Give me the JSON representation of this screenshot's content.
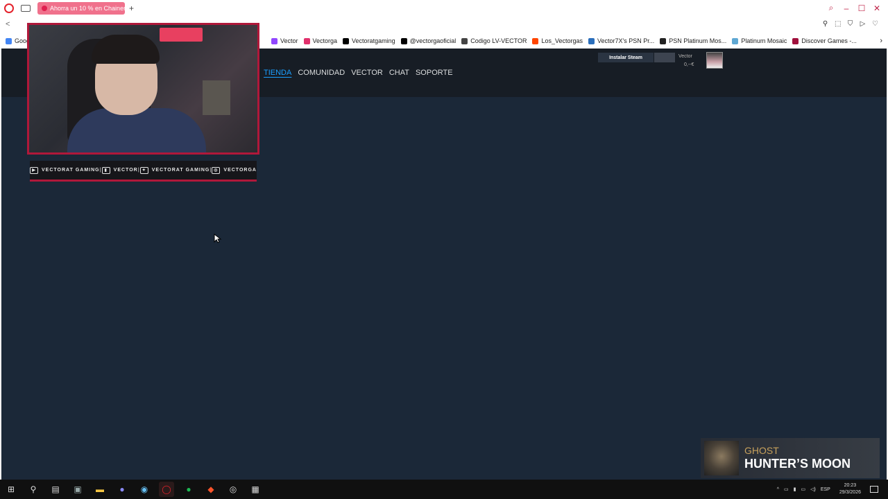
{
  "browser": {
    "tab_title": "Ahorra un 10 % en Chainer",
    "address_right_icons": [
      "pin-icon",
      "snapshot-icon",
      "shield-icon",
      "play-icon",
      "heart-icon"
    ],
    "bookmarks_first": "Goog",
    "bookmarks": [
      {
        "label": "Vector",
        "color": "#9147ff"
      },
      {
        "label": "Vectorga",
        "color": "#e1306c"
      },
      {
        "label": "Vectoratgaming",
        "color": "#000000"
      },
      {
        "label": "@vectorgaoficial",
        "color": "#000000"
      },
      {
        "label": "Codigo LV-VECTOR",
        "color": "#444444"
      },
      {
        "label": "Los_Vectorgas",
        "color": "#ff4500"
      },
      {
        "label": "Vector7X's PSN Pr...",
        "color": "#2a6ebb"
      },
      {
        "label": "PSN Platinum Mos...",
        "color": "#222222"
      },
      {
        "label": "Platinum Mosaic",
        "color": "#5fa8d3"
      },
      {
        "label": "Discover Games -...",
        "color": "#a0103c"
      }
    ]
  },
  "steam": {
    "nav": {
      "store": "TIENDA",
      "community": "COMUNIDAD",
      "user": "VECTOR",
      "chat": "CHAT",
      "support": "SOPORTE"
    },
    "install_label": "Instalar Steam",
    "account_name": "Vector",
    "account_balance": "0,--€"
  },
  "overlay": {
    "socials": [
      {
        "icon": "youtube-icon",
        "label": "VECTORAT GAMING"
      },
      {
        "icon": "twitch-icon",
        "label": "VECTOR"
      },
      {
        "icon": "twitter-icon",
        "label": "VECTORAT GAMING"
      },
      {
        "icon": "instagram-icon",
        "label": "VECTORGA"
      }
    ],
    "now_playing": {
      "artist": "GHOST",
      "title": "HUNTER’S MOON"
    }
  },
  "taskbar": {
    "lang": "ESP",
    "time": "20:23",
    "date": "29/3/2026"
  }
}
